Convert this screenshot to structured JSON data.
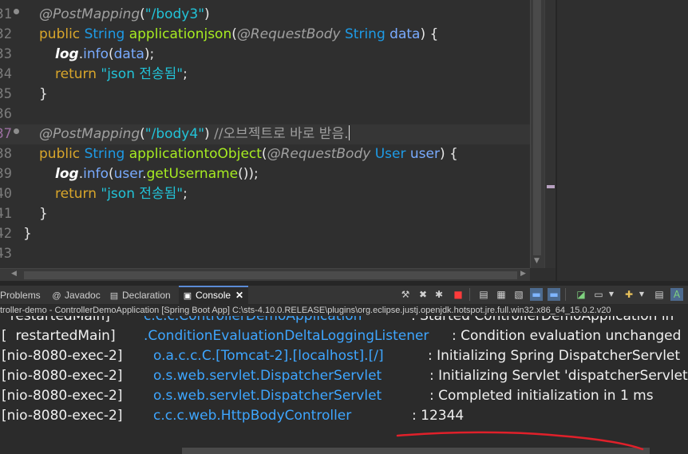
{
  "editor": {
    "lines": [
      {
        "num": "31",
        "fold": true,
        "tokens": [
          {
            "c": "t-ann",
            "t": "@PostMapping"
          },
          {
            "c": "t-plain",
            "t": "("
          },
          {
            "c": "t-str",
            "t": "\"/body3\""
          },
          {
            "c": "t-plain",
            "t": ")"
          }
        ]
      },
      {
        "num": "32",
        "tokens": [
          {
            "c": "t-kw",
            "t": "public "
          },
          {
            "c": "t-type",
            "t": "String "
          },
          {
            "c": "t-fn",
            "t": "applicationjson"
          },
          {
            "c": "t-plain",
            "t": "("
          },
          {
            "c": "t-ann",
            "t": "@RequestBody "
          },
          {
            "c": "t-type",
            "t": "String "
          },
          {
            "c": "t-var",
            "t": "data"
          },
          {
            "c": "t-plain",
            "t": ") {"
          }
        ]
      },
      {
        "num": "33",
        "indent": 2,
        "tokens": [
          {
            "c": "t-log",
            "t": "log"
          },
          {
            "c": "t-plain",
            "t": "."
          },
          {
            "c": "t-var",
            "t": "info"
          },
          {
            "c": "t-plain",
            "t": "("
          },
          {
            "c": "t-var",
            "t": "data"
          },
          {
            "c": "t-plain",
            "t": ");"
          }
        ]
      },
      {
        "num": "34",
        "indent": 2,
        "tokens": [
          {
            "c": "t-kw",
            "t": "return "
          },
          {
            "c": "t-str",
            "t": "\"json 전송됨\""
          },
          {
            "c": "t-plain",
            "t": ";"
          }
        ]
      },
      {
        "num": "35",
        "indent": 1,
        "tokens": [
          {
            "c": "t-plain",
            "t": "}"
          }
        ]
      },
      {
        "num": "36",
        "tokens": []
      },
      {
        "num": "37",
        "fold": true,
        "current": true,
        "tokens": [
          {
            "c": "t-ann",
            "t": "@PostMapping"
          },
          {
            "c": "t-plain",
            "t": "("
          },
          {
            "c": "t-str",
            "t": "\"/body4\""
          },
          {
            "c": "t-plain",
            "t": ") "
          },
          {
            "c": "t-cmt",
            "t": "//오브젝트로 바로 받음."
          }
        ]
      },
      {
        "num": "38",
        "tokens": [
          {
            "c": "t-kw",
            "t": "public "
          },
          {
            "c": "t-type",
            "t": "String "
          },
          {
            "c": "t-fn",
            "t": "applicationtoObject"
          },
          {
            "c": "t-plain",
            "t": "("
          },
          {
            "c": "t-ann",
            "t": "@RequestBody "
          },
          {
            "c": "t-type",
            "t": "User "
          },
          {
            "c": "t-var",
            "t": "user"
          },
          {
            "c": "t-plain",
            "t": ") {"
          }
        ]
      },
      {
        "num": "39",
        "indent": 2,
        "tokens": [
          {
            "c": "t-log",
            "t": "log"
          },
          {
            "c": "t-plain",
            "t": "."
          },
          {
            "c": "t-var",
            "t": "info"
          },
          {
            "c": "t-plain",
            "t": "("
          },
          {
            "c": "t-var",
            "t": "user"
          },
          {
            "c": "t-plain",
            "t": "."
          },
          {
            "c": "t-fn",
            "t": "getUsername"
          },
          {
            "c": "t-plain",
            "t": "());"
          }
        ]
      },
      {
        "num": "40",
        "indent": 2,
        "tokens": [
          {
            "c": "t-kw",
            "t": "return "
          },
          {
            "c": "t-str",
            "t": "\"json 전송됨\""
          },
          {
            "c": "t-plain",
            "t": ";"
          }
        ]
      },
      {
        "num": "41",
        "indent": 1,
        "tokens": [
          {
            "c": "t-plain",
            "t": "}"
          }
        ]
      },
      {
        "num": "42",
        "indent": 0,
        "tokens": [
          {
            "c": "t-plain",
            "t": "}"
          }
        ]
      },
      {
        "num": "43",
        "tokens": []
      }
    ]
  },
  "views": {
    "tabs": [
      {
        "label": "Problems",
        "icon": "problems-icon",
        "glyph": "",
        "active": false
      },
      {
        "label": "Javadoc",
        "icon": "javadoc-icon",
        "glyph": "@",
        "active": false
      },
      {
        "label": "Declaration",
        "icon": "declaration-icon",
        "glyph": "▤",
        "active": false
      },
      {
        "label": "Console",
        "icon": "console-icon",
        "glyph": "▣",
        "active": true,
        "close": "✕"
      }
    ]
  },
  "console": {
    "launch": "troller-demo - ControllerDemoApplication [Spring Boot App] C:\\sts-4.10.0.RELEASE\\plugins\\org.eclipse.justj.openjdk.hotspot.jre.full.win32.x86_64_15.0.2.v20",
    "lines": [
      {
        "thread": "  restartedMain]",
        "logger": "c.c.c.ControllerDemoApplication",
        "message": ": Started ControllerDemoApplication in"
      },
      {
        "thread": "[  restartedMain]",
        "logger": ".ConditionEvaluationDeltaLoggingListener",
        "message": ": Condition evaluation unchanged"
      },
      {
        "thread": "[nio-8080-exec-2]",
        "logger": "o.a.c.c.C.[Tomcat-2].[localhost].[/]",
        "message": ": Initializing Spring DispatcherServlet"
      },
      {
        "thread": "[nio-8080-exec-2]",
        "logger": "o.s.web.servlet.DispatcherServlet",
        "message": ": Initializing Servlet 'dispatcherServlet'"
      },
      {
        "thread": "[nio-8080-exec-2]",
        "logger": "o.s.web.servlet.DispatcherServlet",
        "message": ": Completed initialization in 1 ms"
      },
      {
        "thread": "[nio-8080-exec-2]",
        "logger": "c.c.c.web.HttpBodyController",
        "message": ": 12344"
      }
    ]
  },
  "colors": {
    "annotation_underline": "#e0202a",
    "logger": "#3ea6ff",
    "active_tab_border": "#5b8bd6"
  }
}
